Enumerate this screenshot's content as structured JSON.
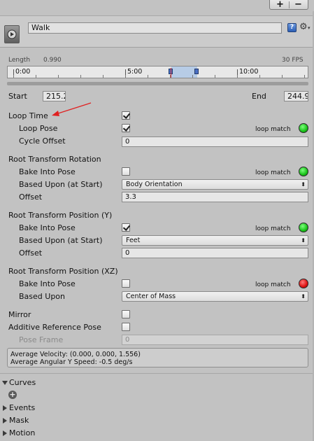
{
  "toolbar": {
    "add_label": "+",
    "remove_label": "−"
  },
  "clip": {
    "name": "Walk"
  },
  "timeline": {
    "length_label": "Length",
    "length_value": "0.990",
    "fps": "30 FPS",
    "ticks": [
      "0:00",
      "5:00",
      "10:00"
    ]
  },
  "range": {
    "start_label": "Start",
    "start_value": "215.2",
    "end_label": "End",
    "end_value": "244.9"
  },
  "loop_time": {
    "label": "Loop Time",
    "checked": true
  },
  "loop_pose": {
    "label": "Loop Pose",
    "checked": true,
    "match_label": "loop match",
    "match_color": "#19c219"
  },
  "cycle_offset": {
    "label": "Cycle Offset",
    "value": "0"
  },
  "rotation": {
    "header": "Root Transform Rotation",
    "bake_label": "Bake Into Pose",
    "bake_checked": false,
    "match_label": "loop match",
    "match_color": "#19c219",
    "based_label": "Based Upon (at Start)",
    "based_value": "Body Orientation",
    "offset_label": "Offset",
    "offset_value": "3.3"
  },
  "position_y": {
    "header": "Root Transform Position (Y)",
    "bake_label": "Bake Into Pose",
    "bake_checked": true,
    "match_label": "loop match",
    "match_color": "#19c219",
    "based_label": "Based Upon (at Start)",
    "based_value": "Feet",
    "offset_label": "Offset",
    "offset_value": "0"
  },
  "position_xz": {
    "header": "Root Transform Position (XZ)",
    "bake_label": "Bake Into Pose",
    "bake_checked": false,
    "match_label": "loop match",
    "match_color": "#dd1111",
    "based_label": "Based Upon",
    "based_value": "Center of Mass"
  },
  "mirror": {
    "label": "Mirror",
    "checked": false
  },
  "additive": {
    "label": "Additive Reference Pose",
    "checked": false
  },
  "pose_frame": {
    "label": "Pose Frame",
    "value": "0"
  },
  "info": {
    "velocity": "Average Velocity: (0.000, 0.000, 1.556)",
    "angular": "Average Angular Y Speed: -0.5 deg/s"
  },
  "sections": {
    "curves": "Curves",
    "events": "Events",
    "mask": "Mask",
    "motion": "Motion"
  }
}
